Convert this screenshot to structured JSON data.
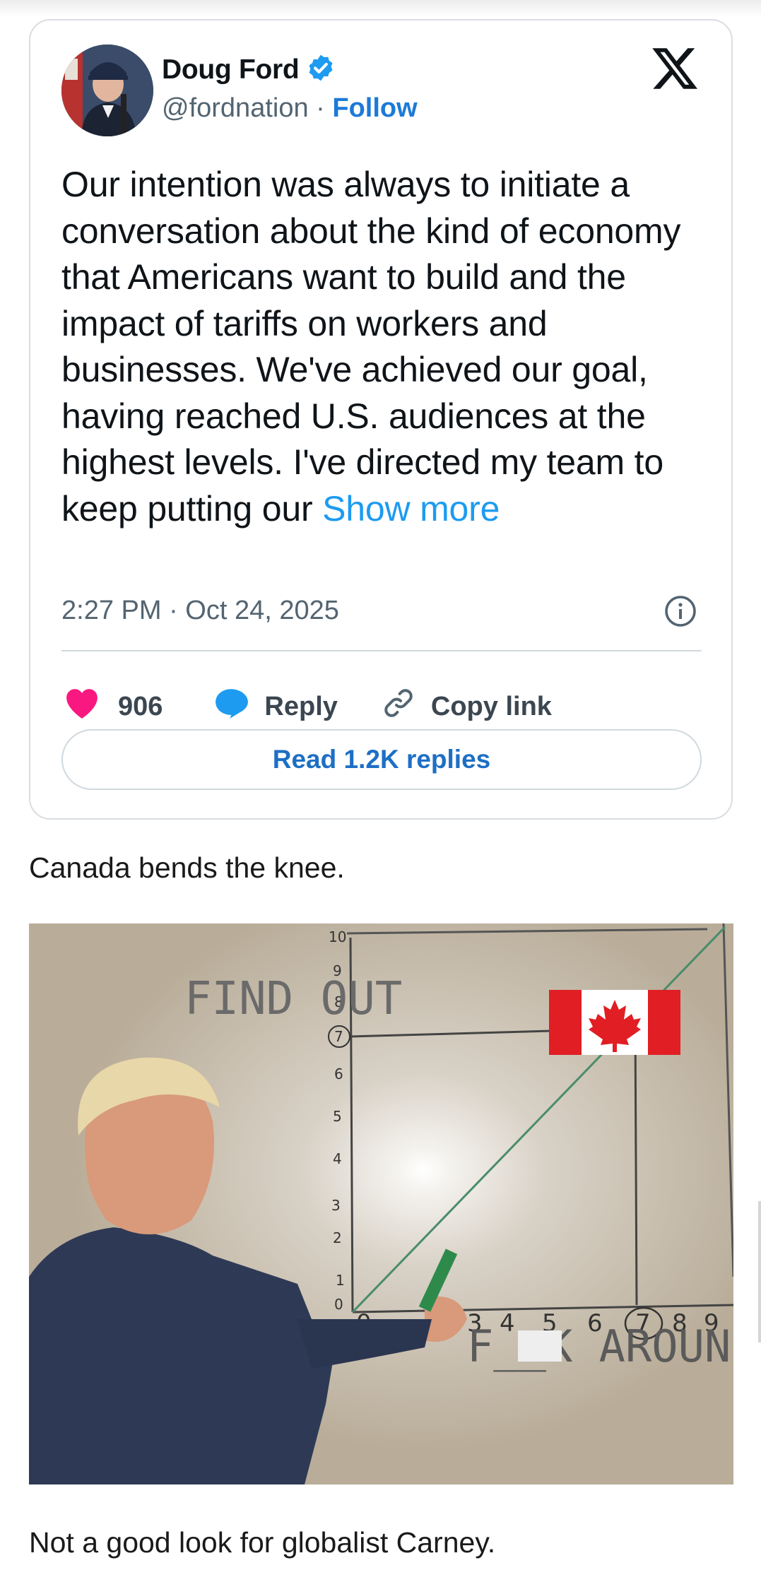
{
  "tweet": {
    "author": {
      "name": "Doug Ford",
      "handle": "@fordnation",
      "separator": "·",
      "follow_label": "Follow"
    },
    "text": "Our intention was always to initiate a conversation about the kind of economy that Americans want to build and the impact of tariffs on workers and businesses. We've achieved our goal, having reached U.S. audiences at the highest levels. I've directed my team to keep putting our",
    "show_more_label": "Show more",
    "timestamp": "2:27 PM · Oct 24, 2025",
    "likes": "906",
    "reply_label": "Reply",
    "copy_link_label": "Copy link",
    "read_replies_label": "Read 1.2K replies",
    "icons": [
      "verified-badge-icon",
      "x-logo-icon",
      "info-icon",
      "heart-icon",
      "reply-bubble-icon",
      "link-icon"
    ],
    "colors": {
      "follow": "#1d7ad7",
      "heart": "#f91880",
      "reply": "#1d9bf0",
      "verified": "#1d9bf0"
    }
  },
  "caption_top": "Canada bends the knee.",
  "meme": {
    "y_label": "FIND OUT",
    "x_label": "F__K AROUND",
    "y_ticks": [
      "10",
      "9",
      "8",
      "7",
      "6",
      "5",
      "4",
      "3",
      "2",
      "1",
      "0"
    ],
    "x_ticks": [
      "0",
      "3",
      "4",
      "5",
      "6",
      "7",
      "8",
      "9"
    ],
    "circled_value": "7",
    "flag": "canada-flag"
  },
  "caption_bottom": "Not a good look for globalist Carney."
}
